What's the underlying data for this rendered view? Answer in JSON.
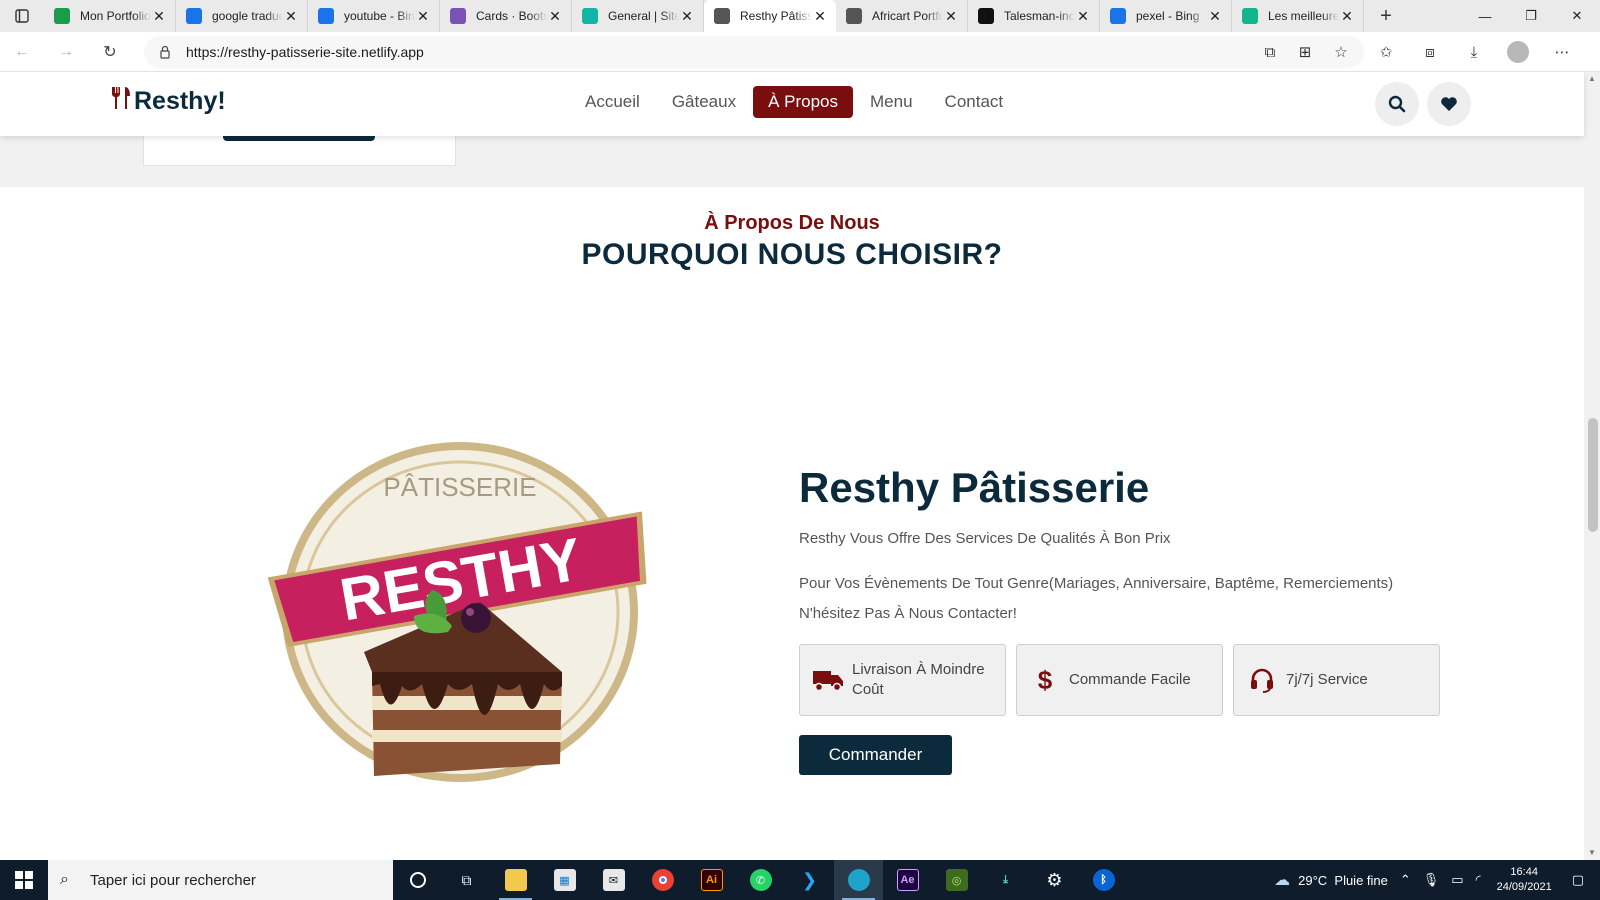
{
  "browser": {
    "tabs": [
      {
        "title": "Mon Portfolio",
        "favicon": "check-circle-icon",
        "color": "#1a9c4a"
      },
      {
        "title": "google traduction",
        "favicon": "bing-icon",
        "color": "#1a73e8"
      },
      {
        "title": "youtube - Bing",
        "favicon": "bing-icon",
        "color": "#1a73e8"
      },
      {
        "title": "Cards · Bootstrap",
        "favicon": "bootstrap-icon",
        "color": "#7952b3"
      },
      {
        "title": "General | Site",
        "favicon": "diamond-icon",
        "color": "#13b5a6"
      },
      {
        "title": "Resthy Pâtisserie",
        "favicon": "page-icon",
        "color": "#555555",
        "active": true
      },
      {
        "title": "Africart Portfolio",
        "favicon": "page-icon",
        "color": "#555555"
      },
      {
        "title": "Talesman-inc",
        "favicon": "github-icon",
        "color": "#111111"
      },
      {
        "title": "pexel - Bing",
        "favicon": "bing-icon",
        "color": "#1a73e8"
      },
      {
        "title": "Les meilleures",
        "favicon": "d-icon",
        "color": "#13b58a"
      }
    ],
    "url": "https://resthy-patisserie-site.netlify.app"
  },
  "site": {
    "brand": "Resthy!",
    "nav": [
      "Accueil",
      "Gâteaux",
      "À Propos",
      "Menu",
      "Contact"
    ],
    "active_nav": "À Propos",
    "colors": {
      "primary": "#0b2a3c",
      "accent": "#7a0e0e"
    }
  },
  "about": {
    "subtitle": "À Propos De Nous",
    "title": "POURQUOI NOUS CHOISIR?",
    "logo_text": {
      "top": "PÂTISSERIE",
      "banner": "RESTHY"
    },
    "heading": "Resthy Pâtisserie",
    "p1": "Resthy Vous Offre Des Services De Qualités À Bon Prix",
    "p2": "Pour Vos Évènements De Tout Genre(Mariages, Anniversaire, Baptême, Remerciements) N'hésitez Pas À Nous Contacter!",
    "features": [
      {
        "icon": "truck-icon",
        "label": "Livraison À Moindre Coût"
      },
      {
        "icon": "dollar-icon",
        "label": "Commande Facile"
      },
      {
        "icon": "headset-icon",
        "label": "7j/7j Service"
      }
    ],
    "cta": "Commander"
  },
  "taskbar": {
    "search_placeholder": "Taper ici pour rechercher",
    "weather": "29°C  Pluie fine",
    "time": "16:44",
    "date": "24/09/2021"
  }
}
